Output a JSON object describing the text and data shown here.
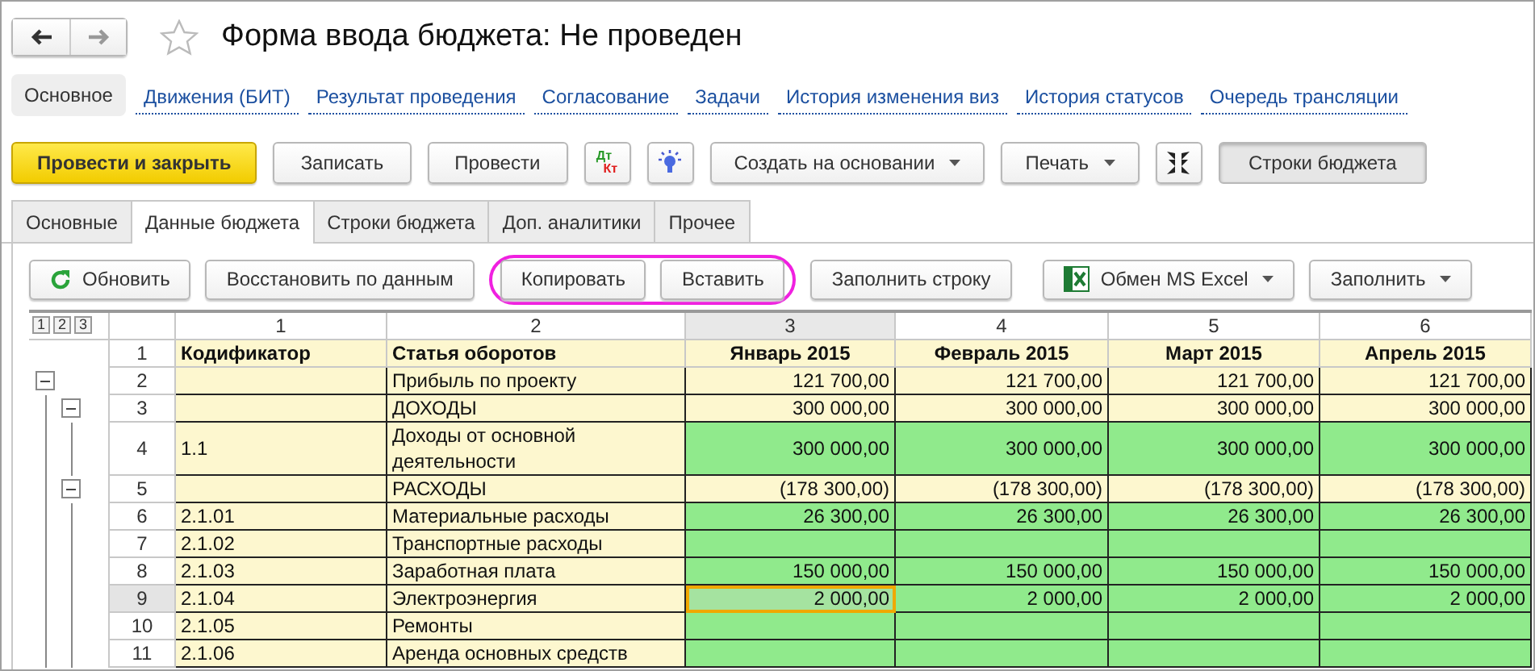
{
  "window": {
    "title": "Форма ввода бюджета: Не проведен",
    "favorite": false
  },
  "nav_links": [
    {
      "label": "Основное",
      "selected": true
    },
    {
      "label": "Движения (БИТ)",
      "selected": false
    },
    {
      "label": "Результат проведения",
      "selected": false
    },
    {
      "label": "Согласование",
      "selected": false
    },
    {
      "label": "Задачи",
      "selected": false
    },
    {
      "label": "История изменения виз",
      "selected": false
    },
    {
      "label": "История статусов",
      "selected": false
    },
    {
      "label": "Очередь трансляции",
      "selected": false
    }
  ],
  "command_bar": [
    {
      "kind": "primary",
      "label": "Провести и закрыть",
      "pressed": false
    },
    {
      "kind": "button",
      "label": "Записать",
      "pressed": false
    },
    {
      "kind": "button",
      "label": "Провести",
      "pressed": false
    },
    {
      "kind": "accounts",
      "top": "Дт",
      "bottom": "Кт",
      "pressed": false
    },
    {
      "kind": "bulb",
      "pressed": false
    },
    {
      "kind": "dropdown",
      "label": "Создать на основании",
      "pressed": false
    },
    {
      "kind": "dropdown",
      "label": "Печать",
      "pressed": false
    },
    {
      "kind": "collapse",
      "pressed": false
    },
    {
      "kind": "button",
      "label": "Строки бюджета",
      "pressed": true
    }
  ],
  "tabs": [
    {
      "label": "Основные",
      "selected": false
    },
    {
      "label": "Данные бюджета",
      "selected": true
    },
    {
      "label": "Строки бюджета",
      "selected": false
    },
    {
      "label": "Доп. аналитики",
      "selected": false
    },
    {
      "label": "Прочее",
      "selected": false
    }
  ],
  "table_toolbar": [
    {
      "kind": "refresh",
      "label": "Обновить",
      "highlighted": false
    },
    {
      "kind": "button",
      "label": "Восстановить по данным",
      "highlighted": false
    },
    {
      "kind": "button",
      "label": "Копировать",
      "highlighted": true
    },
    {
      "kind": "button",
      "label": "Вставить",
      "highlighted": true
    },
    {
      "kind": "button",
      "label": "Заполнить строку",
      "highlighted": false
    },
    {
      "kind": "excel",
      "label": "Обмен MS Excel",
      "highlighted": false
    },
    {
      "kind": "dropdown",
      "label": "Заполнить",
      "highlighted": false
    }
  ],
  "table": {
    "levels": [
      "1",
      "2",
      "3"
    ],
    "header_row_number": "1",
    "columns": [
      {
        "number": "1",
        "title": "Кодификатор",
        "selected": false
      },
      {
        "number": "2",
        "title": "Статья оборотов",
        "selected": false
      },
      {
        "number": "3",
        "title": "Январь 2015",
        "selected": true
      },
      {
        "number": "4",
        "title": "Февраль 2015",
        "selected": false
      },
      {
        "number": "5",
        "title": "Март 2015",
        "selected": false
      },
      {
        "number": "6",
        "title": "Апрель 2015",
        "selected": false
      }
    ],
    "rows": [
      {
        "number": "2",
        "name": "Прибыль по проекту",
        "kind": "total",
        "selected": false,
        "expanded": true,
        "amounts": [
          "121 700,00",
          "121 700,00",
          "121 700,00",
          "121 700,00"
        ],
        "children": [
          {
            "number": "3",
            "name": "ДОХОДЫ",
            "kind": "total",
            "selected": false,
            "expanded": true,
            "amounts": [
              "300 000,00",
              "300 000,00",
              "300 000,00",
              "300 000,00"
            ],
            "children": [
              {
                "number": "4",
                "code": "1.1",
                "name": "Доходы от основной деятельности",
                "kind": "input",
                "selected": false,
                "amounts": [
                  "300 000,00",
                  "300 000,00",
                  "300 000,00",
                  "300 000,00"
                ]
              }
            ]
          },
          {
            "number": "5",
            "name": "РАСХОДЫ",
            "kind": "total",
            "selected": false,
            "expanded": true,
            "amounts": [
              "(178 300,00)",
              "(178 300,00)",
              "(178 300,00)",
              "(178 300,00)"
            ],
            "children": [
              {
                "number": "6",
                "code": "2.1.01",
                "name": "Материальные расходы",
                "kind": "input",
                "selected": false,
                "amounts": [
                  "26 300,00",
                  "26 300,00",
                  "26 300,00",
                  "26 300,00"
                ]
              },
              {
                "number": "7",
                "code": "2.1.02",
                "name": "Транспортные расходы",
                "kind": "input",
                "selected": false
              },
              {
                "number": "8",
                "code": "2.1.03",
                "name": "Заработная плата",
                "kind": "input",
                "selected": false,
                "amounts": [
                  "150 000,00",
                  "150 000,00",
                  "150 000,00",
                  "150 000,00"
                ]
              },
              {
                "number": "9",
                "code": "2.1.04",
                "name": "Электроэнергия",
                "kind": "input",
                "selected": true,
                "amounts": [
                  "2 000,00",
                  "2 000,00",
                  "2 000,00",
                  "2 000,00"
                ]
              },
              {
                "number": "10",
                "code": "2.1.05",
                "name": "Ремонты",
                "kind": "input",
                "selected": false
              },
              {
                "number": "11",
                "code": "2.1.06",
                "name": "Аренда основных средств",
                "kind": "input",
                "selected": false
              }
            ]
          }
        ]
      }
    ]
  }
}
